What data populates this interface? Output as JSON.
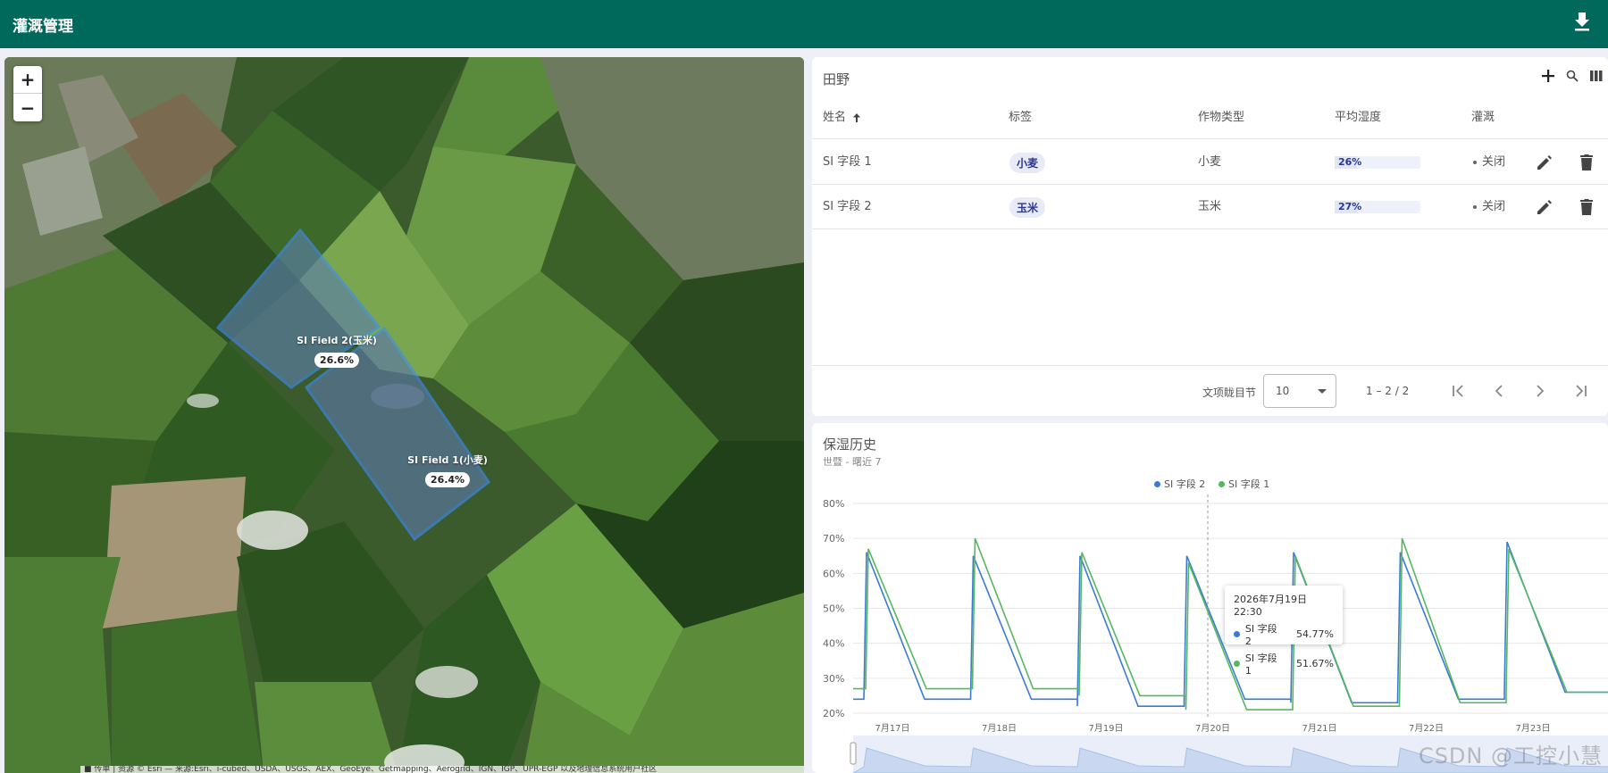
{
  "app": {
    "title": "灌溉管理"
  },
  "map": {
    "zoom_in": "+",
    "zoom_out": "−",
    "fields": [
      {
        "label": "SI Field 2(玉米)",
        "pct": "26.6%"
      },
      {
        "label": "SI Field 1(小麦)",
        "pct": "26.4%"
      }
    ],
    "attribution": "■ 传单 | 资源 © Esri — 来源:Esri、i-cubed、USDA、USGS、AEX、GeoEye、Getmapping、Aerogrid、IGN、IGP、UPR-EGP 以及地理信息系统用户社区"
  },
  "table": {
    "title": "田野",
    "columns": [
      "姓名",
      "标签",
      "作物类型",
      "平均湿度",
      "灌溉"
    ],
    "rows": [
      {
        "name": "SI 字段 1",
        "tag": "小麦",
        "crop": "小麦",
        "moisture": "26%",
        "moisture_value": 26,
        "irrigation": "关闭"
      },
      {
        "name": "SI 字段 2",
        "tag": "玉米",
        "crop": "玉米",
        "moisture": "27%",
        "moisture_value": 27,
        "irrigation": "关闭"
      }
    ],
    "pager": {
      "rows_label": "文项眬目节",
      "rows_per_page": "10",
      "range": "1 – 2 / 2"
    }
  },
  "chart": {
    "title": "保湿历史",
    "subtitle": "世暨 - 曙近 7",
    "tooltip": {
      "date": "2026年7月19日 22:30",
      "s2_label": "SI 字段 2",
      "s2_value": "54.77%",
      "s1_label": "SI 字段 1",
      "s1_value": "51.67%"
    },
    "watermark": "CSDN @工控小慧"
  },
  "chart_data": {
    "type": "line",
    "title": "保湿历史",
    "x": [
      "7月17日",
      "7月18日",
      "7月19日",
      "7月20日",
      "7月21日",
      "7月22日",
      "7月23日"
    ],
    "y_ticks": [
      "20%",
      "30%",
      "40%",
      "50%",
      "60%",
      "70%",
      "80%"
    ],
    "ylim": [
      20,
      80
    ],
    "legend": "top-center",
    "grid": true,
    "colors": {
      "SI 字段 2": "#3a7bd5",
      "SI 字段 1": "#55b85c"
    },
    "series": [
      {
        "name": "SI 字段 2",
        "peaks": [
          66,
          65,
          65,
          65,
          66,
          66,
          69
        ],
        "troughs": [
          24,
          24,
          22,
          24,
          23,
          24,
          26
        ]
      },
      {
        "name": "SI 字段 1",
        "peaks": [
          67,
          70,
          66,
          63,
          65,
          70,
          67
        ],
        "troughs": [
          27,
          27,
          25,
          21,
          22,
          23,
          26
        ]
      }
    ]
  }
}
